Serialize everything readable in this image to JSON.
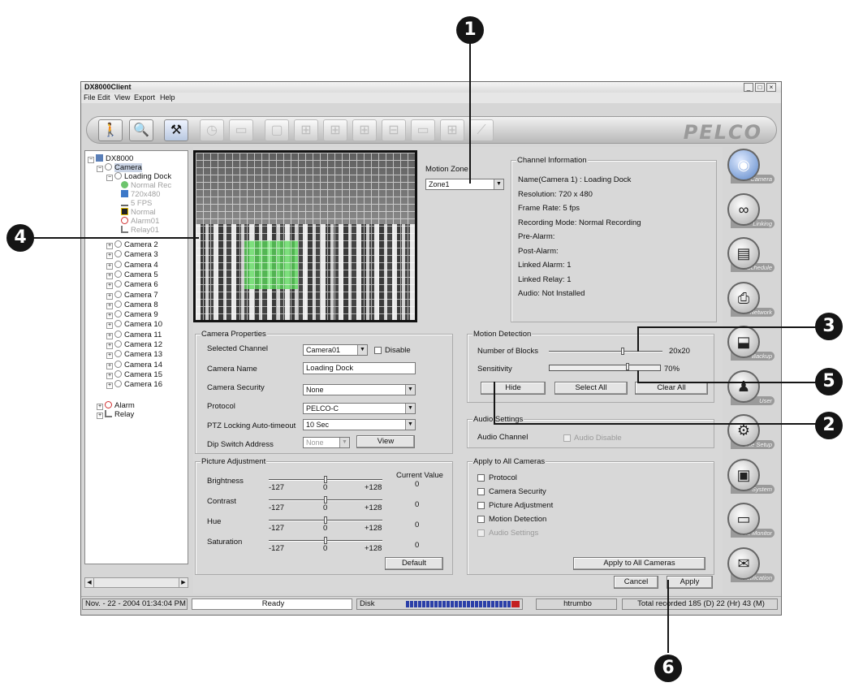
{
  "window": {
    "title": "DX8000Client",
    "controls": [
      "_",
      "□",
      "×"
    ]
  },
  "menu": [
    "File",
    "Edit",
    "View",
    "Export",
    "Help"
  ],
  "toolbar": {
    "logo": "PELCO",
    "buttons": [
      {
        "icon": "person-icon",
        "glyph": "🚶"
      },
      {
        "icon": "search-icon",
        "glyph": "🔍"
      },
      {
        "icon": "tools-icon",
        "glyph": "⚒"
      },
      {
        "icon": "clock-icon",
        "glyph": "◷"
      },
      {
        "icon": "printer-icon",
        "glyph": "▭"
      },
      {
        "icon": "layout-1-icon",
        "glyph": "▢"
      },
      {
        "icon": "layout-4-icon",
        "glyph": "⊞"
      },
      {
        "icon": "layout-9-icon",
        "glyph": "⊞"
      },
      {
        "icon": "layout-16-icon",
        "glyph": "⊞"
      },
      {
        "icon": "layout-6-icon",
        "glyph": "⊟"
      },
      {
        "icon": "layout-2-icon",
        "glyph": "▭"
      },
      {
        "icon": "layout-8-icon",
        "glyph": "⊞"
      },
      {
        "icon": "sequence-icon",
        "glyph": "⟋"
      }
    ]
  },
  "tree": {
    "root": "DX8000",
    "camera_group": "Camera",
    "camera1": "Loading Dock",
    "camera1_details": [
      "Normal Rec",
      "720x480",
      "5 FPS",
      "Normal",
      "Alarm01",
      "Relay01"
    ],
    "cameras": [
      "Camera 2",
      "Camera 3",
      "Camera 4",
      "Camera 5",
      "Camera 6",
      "Camera 7",
      "Camera 8",
      "Camera 9",
      "Camera 10",
      "Camera 11",
      "Camera 12",
      "Camera 13",
      "Camera 14",
      "Camera 15",
      "Camera 16"
    ],
    "alarm": "Alarm",
    "relay": "Relay"
  },
  "motion_zone": {
    "label": "Motion Zone",
    "value": "Zone1"
  },
  "channel_info": {
    "title": "Channel Information",
    "lines": [
      "Name(Camera 1) : Loading Dock",
      "Resolution: 720 x 480",
      "Frame Rate:  5 fps",
      "Recording Mode: Normal Recording",
      "Pre-Alarm:",
      "Post-Alarm:",
      "Linked Alarm: 1",
      "Linked Relay: 1",
      "Audio: Not Installed"
    ]
  },
  "camera_properties": {
    "title": "Camera Properties",
    "selected_channel_label": "Selected Channel",
    "selected_channel": "Camera01",
    "disable_label": "Disable",
    "camera_name_label": "Camera Name",
    "camera_name": "Loading Dock",
    "camera_security_label": "Camera Security",
    "camera_security": "None",
    "protocol_label": "Protocol",
    "protocol": "PELCO-C",
    "ptz_label": "PTZ Locking Auto-timeout",
    "ptz": "10 Sec",
    "dip_label": "Dip Switch Address",
    "dip": "None",
    "view_button": "View"
  },
  "picture_adjustment": {
    "title": "Picture Adjustment",
    "current_value_label": "Current Value",
    "rows": [
      {
        "label": "Brightness",
        "min": "-127",
        "mid": "0",
        "max": "+128",
        "value": "0"
      },
      {
        "label": "Contrast",
        "min": "-127",
        "mid": "0",
        "max": "+128",
        "value": "0"
      },
      {
        "label": "Hue",
        "min": "-127",
        "mid": "0",
        "max": "+128",
        "value": "0"
      },
      {
        "label": "Saturation",
        "min": "-127",
        "mid": "0",
        "max": "+128",
        "value": "0"
      }
    ],
    "default_button": "Default"
  },
  "motion_detection": {
    "title": "Motion Detection",
    "blocks_label": "Number of Blocks",
    "blocks_value": "20x20",
    "blocks_level": 0.65,
    "sensitivity_label": "Sensitivity",
    "sensitivity_value": "70%",
    "sensitivity_level": 0.7,
    "hide_button": "Hide",
    "select_all_button": "Select All",
    "clear_all_button": "Clear All"
  },
  "audio_settings": {
    "title": "Audio Settings",
    "channel_label": "Audio Channel",
    "disable_label": "Audio Disable"
  },
  "apply_all": {
    "title": "Apply to All Cameras",
    "options": [
      "Protocol",
      "Camera Security",
      "Picture Adjustment",
      "Motion Detection",
      "Audio Settings"
    ],
    "button": "Apply to All Cameras"
  },
  "footer_buttons": {
    "cancel": "Cancel",
    "apply": "Apply"
  },
  "right_panel": [
    {
      "label": "Camera",
      "icon": "camera-icon",
      "glyph": "◉"
    },
    {
      "label": "Linking",
      "icon": "link-icon",
      "glyph": "∞"
    },
    {
      "label": "Schedule",
      "icon": "schedule-icon",
      "glyph": "▤"
    },
    {
      "label": "Network",
      "icon": "network-icon",
      "glyph": "⎙"
    },
    {
      "label": "Backup",
      "icon": "backup-icon",
      "glyph": "⬓"
    },
    {
      "label": "User",
      "icon": "user-icon",
      "glyph": "♟"
    },
    {
      "label": "Site Setup",
      "icon": "site-setup-icon",
      "glyph": "⚙"
    },
    {
      "label": "System",
      "icon": "system-icon",
      "glyph": "▣"
    },
    {
      "label": "Ext Monitor",
      "icon": "monitor-icon",
      "glyph": "▭"
    },
    {
      "label": "Notification",
      "icon": "notification-icon",
      "glyph": "✉"
    }
  ],
  "status": {
    "datetime": "Nov. - 22 - 2004  01:34:04 PM",
    "state": "Ready",
    "disk_label": "Disk",
    "user": "htrumbo",
    "recorded": "Total recorded 185 (D) 22 (Hr) 43 (M)"
  },
  "callouts": [
    "1",
    "2",
    "3",
    "4",
    "5",
    "6"
  ]
}
